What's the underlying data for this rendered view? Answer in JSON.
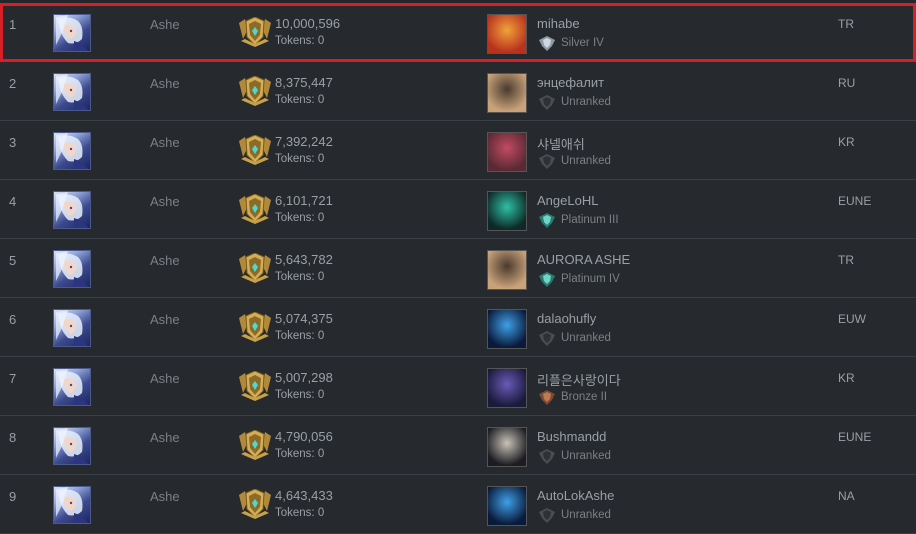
{
  "leaderboard": {
    "rows": [
      {
        "rank": "1",
        "champion": "Ashe",
        "points": "10,000,596",
        "tokens": "Tokens: 0",
        "summoner": "mihabe",
        "tier": "Silver IV",
        "region": "TR",
        "avatar_colors": [
          "#b8321e",
          "#f0a23a"
        ],
        "tier_icon": "silver-emblem-icon",
        "highlighted": true
      },
      {
        "rank": "2",
        "champion": "Ashe",
        "points": "8,375,447",
        "tokens": "Tokens: 0",
        "summoner": "энцефалит",
        "tier": "Unranked",
        "region": "RU",
        "avatar_colors": [
          "#c9a27a",
          "#4a3a2e"
        ],
        "tier_icon": "unranked-emblem-icon",
        "highlighted": false
      },
      {
        "rank": "3",
        "champion": "Ashe",
        "points": "7,392,242",
        "tokens": "Tokens: 0",
        "summoner": "샤넬애쉬",
        "tier": "Unranked",
        "region": "KR",
        "avatar_colors": [
          "#5a2a34",
          "#c24a62"
        ],
        "tier_icon": "unranked-emblem-icon",
        "highlighted": false
      },
      {
        "rank": "4",
        "champion": "Ashe",
        "points": "6,101,721",
        "tokens": "Tokens: 0",
        "summoner": "AngeLoHL",
        "tier": "Platinum III",
        "region": "EUNE",
        "avatar_colors": [
          "#0e2a28",
          "#2fbfa4"
        ],
        "tier_icon": "platinum-emblem-icon",
        "highlighted": false
      },
      {
        "rank": "5",
        "champion": "Ashe",
        "points": "5,643,782",
        "tokens": "Tokens: 0",
        "summoner": "AURORA ASHE",
        "tier": "Platinum IV",
        "region": "TR",
        "avatar_colors": [
          "#c9a27a",
          "#4a3a2e"
        ],
        "tier_icon": "platinum-emblem-icon",
        "highlighted": false
      },
      {
        "rank": "6",
        "champion": "Ashe",
        "points": "5,074,375",
        "tokens": "Tokens: 0",
        "summoner": "dalaohufly",
        "tier": "Unranked",
        "region": "EUW",
        "avatar_colors": [
          "#0a1a3a",
          "#3fa0e8"
        ],
        "tier_icon": "unranked-emblem-icon",
        "highlighted": false
      },
      {
        "rank": "7",
        "champion": "Ashe",
        "points": "5,007,298",
        "tokens": "Tokens: 0",
        "summoner": "리플은사랑이다",
        "tier": "Bronze II",
        "region": "KR",
        "avatar_colors": [
          "#1a1a3a",
          "#6a5ab8"
        ],
        "tier_icon": "bronze-emblem-icon",
        "highlighted": false
      },
      {
        "rank": "8",
        "champion": "Ashe",
        "points": "4,790,056",
        "tokens": "Tokens: 0",
        "summoner": "Bushmandd",
        "tier": "Unranked",
        "region": "EUNE",
        "avatar_colors": [
          "#1c1c22",
          "#c8c2b8"
        ],
        "tier_icon": "unranked-emblem-icon",
        "highlighted": false
      },
      {
        "rank": "9",
        "champion": "Ashe",
        "points": "4,643,433",
        "tokens": "Tokens: 0",
        "summoner": "AutoLokAshe",
        "tier": "Unranked",
        "region": "NA",
        "avatar_colors": [
          "#0a1a3a",
          "#3fa0e8"
        ],
        "tier_icon": "unranked-emblem-icon",
        "highlighted": false
      }
    ]
  },
  "colors": {
    "background": "#24272b",
    "divider": "#3a3f45",
    "highlight": "#d61f26",
    "mastery_gold": "#c8a24a",
    "mastery_gem": "#4fd8d0"
  }
}
